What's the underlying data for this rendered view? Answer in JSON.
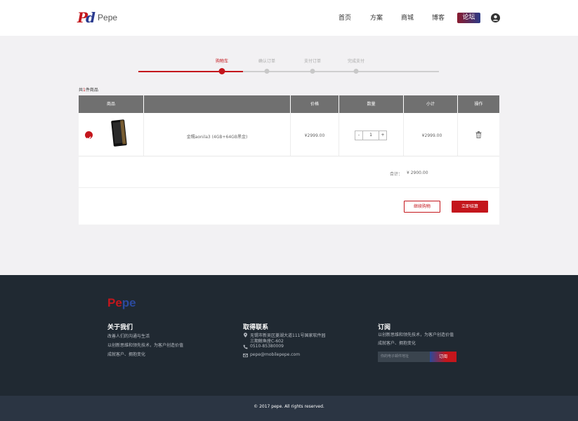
{
  "brand": {
    "logo_text": "Pepe"
  },
  "nav": {
    "items": [
      "首页",
      "方案",
      "商城",
      "博客"
    ],
    "forum": "论坛"
  },
  "steps": [
    {
      "label": "购物车",
      "active": true
    },
    {
      "label": "确认订单",
      "active": false
    },
    {
      "label": "支付订单",
      "active": false
    },
    {
      "label": "完成支付",
      "active": false
    }
  ],
  "cart": {
    "count_prefix": "共",
    "count": "1",
    "count_suffix": "件商品",
    "columns": [
      "商品",
      "价格",
      "数量",
      "小计",
      "操作"
    ],
    "item": {
      "name": "金糯aonila3 (4GB+64GB黑金)",
      "price": "¥2999.00",
      "qty": "1",
      "subtotal": "¥2999.00"
    },
    "minus": "-",
    "plus": "+",
    "total_label": "合计：",
    "total": "¥ 2900.00",
    "continue_label": "继续购物",
    "checkout_label": "立即结算"
  },
  "footer": {
    "logo": {
      "part1": "Pe",
      "part2": "pe"
    },
    "about": {
      "title": "关于我们",
      "lines": [
        "改善人们的沟通与生活",
        "以创新思维和领先技术，为客户创造价值",
        "成就客户、拥抱变化"
      ]
    },
    "contact": {
      "title": "取得联系",
      "address_line1": "无锡市新吴区菱湖大道111号国家软件园",
      "address_line2": "三期鲸鱼座C-602",
      "phone": "0510-85380009",
      "email": "pepe@mobilepepe.com"
    },
    "subscribe": {
      "title": "订阅",
      "lines": [
        "以创新思维和领先技术，为客户创造价值",
        "成就客户、拥抱变化"
      ],
      "placeholder": "你的电子邮件地址",
      "button": "订阅"
    },
    "copyright": "© 2017 pepe. All rights reserved."
  },
  "colors": {
    "accent": "#c4161c",
    "footer_bg": "#202932",
    "header_bar": "#707070"
  },
  "icons": [
    "user-icon",
    "check-icon",
    "trash-icon",
    "location-icon",
    "phone-icon",
    "mail-icon"
  ]
}
